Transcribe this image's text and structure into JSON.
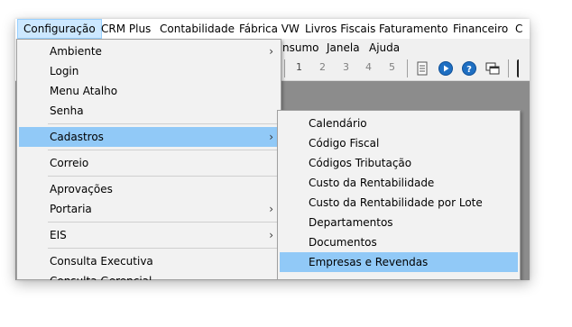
{
  "menubar": {
    "items": [
      "Configuração",
      "CRM Plus",
      "Contabilidade",
      "Fábrica VW",
      "Livros Fiscais",
      "Faturamento",
      "Financeiro",
      "C"
    ]
  },
  "menubar2": {
    "items": [
      "nsumo",
      "Janela",
      "Ajuda"
    ]
  },
  "toolbar": {
    "pages": [
      "1",
      "2",
      "3",
      "4",
      "5"
    ],
    "icons": [
      "document-icon",
      "play-circle-icon",
      "help-circle-icon",
      "window-icon"
    ]
  },
  "config_menu": {
    "items": [
      {
        "label": "Ambiente",
        "submenu": true
      },
      {
        "label": "Login",
        "submenu": false
      },
      {
        "label": "Menu Atalho",
        "submenu": false
      },
      {
        "label": "Senha",
        "submenu": false
      },
      {
        "label": "Cadastros",
        "submenu": true
      },
      {
        "label": "Correio",
        "submenu": false
      },
      {
        "label": "Aprovações",
        "submenu": false
      },
      {
        "label": "Portaria",
        "submenu": true
      },
      {
        "label": "EIS",
        "submenu": true
      },
      {
        "label": "Consulta Executiva",
        "submenu": false
      },
      {
        "label": "Consulta Gerencial",
        "submenu": false
      }
    ]
  },
  "cadastros_menu": {
    "items": [
      {
        "label": "Calendário"
      },
      {
        "label": "Código Fiscal"
      },
      {
        "label": "Códigos Tributação"
      },
      {
        "label": "Custo da Rentabilidade"
      },
      {
        "label": "Custo da Rentabilidade por Lote"
      },
      {
        "label": "Departamentos"
      },
      {
        "label": "Documentos"
      },
      {
        "label": "Empresas e Revendas"
      }
    ]
  },
  "colors": {
    "highlight": "#91c9f7",
    "menubar_active": "#cce8ff",
    "workspace": "#8c8c8c"
  }
}
